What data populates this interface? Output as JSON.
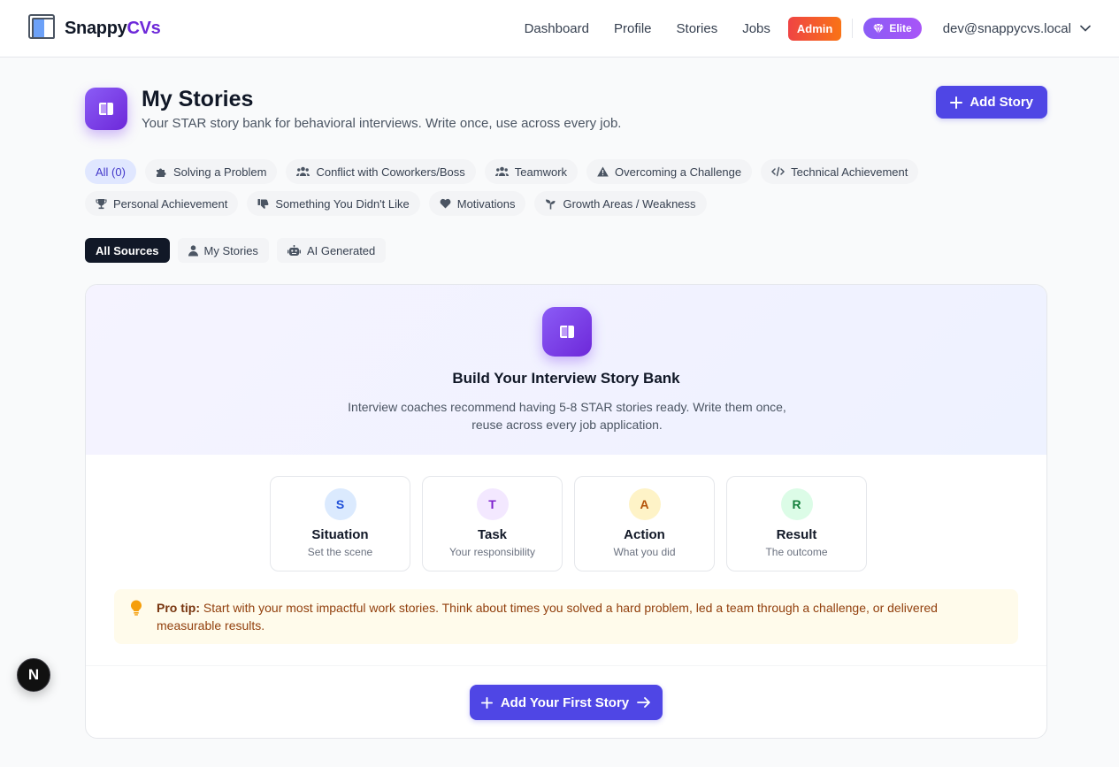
{
  "app": {
    "brand_part1": "Snappy",
    "brand_part2": "CVs",
    "accent": "#4f46e5",
    "brand_color": "#6d28d9"
  },
  "nav": {
    "links": [
      "Dashboard",
      "Profile",
      "Stories",
      "Jobs"
    ],
    "admin_badge": "Admin",
    "elite_badge": "Elite",
    "user_email": "dev@snappycvs.local"
  },
  "page": {
    "title": "My Stories",
    "subtitle": "Your STAR story bank for behavioral interviews. Write once, use across every job.",
    "add_button": "Add Story"
  },
  "categories": {
    "row1": [
      {
        "label": "All (0)",
        "icon": "none",
        "active": true
      },
      {
        "label": "Solving a Problem",
        "icon": "puzzle-icon"
      },
      {
        "label": "Conflict with Coworkers/Boss",
        "icon": "users-icon"
      },
      {
        "label": "Teamwork",
        "icon": "users-icon"
      },
      {
        "label": "Overcoming a Challenge",
        "icon": "warning-icon"
      },
      {
        "label": "Technical Achievement",
        "icon": "code-icon"
      }
    ],
    "row2": [
      {
        "label": "Personal Achievement",
        "icon": "trophy-icon"
      },
      {
        "label": "Something You Didn't Like",
        "icon": "thumbs-down-icon"
      },
      {
        "label": "Motivations",
        "icon": "heart-icon"
      },
      {
        "label": "Growth Areas / Weakness",
        "icon": "seedling-icon"
      }
    ]
  },
  "sources": [
    {
      "label": "All Sources",
      "active": true
    },
    {
      "label": "My Stories",
      "icon": "user-icon"
    },
    {
      "label": "AI Generated",
      "icon": "robot-icon"
    }
  ],
  "empty_state": {
    "title": "Build Your Interview Story Bank",
    "description": "Interview coaches recommend having 5-8 STAR stories ready. Write them once, reuse across every job application.",
    "star": [
      {
        "letter": "S",
        "name": "Situation",
        "desc": "Set the scene",
        "bg": "#dbeafe",
        "fg": "#1d4ed8"
      },
      {
        "letter": "T",
        "name": "Task",
        "desc": "Your responsibility",
        "bg": "#f3e8ff",
        "fg": "#7e22ce"
      },
      {
        "letter": "A",
        "name": "Action",
        "desc": "What you did",
        "bg": "#fef3c7",
        "fg": "#b45309"
      },
      {
        "letter": "R",
        "name": "Result",
        "desc": "The outcome",
        "bg": "#dcfce7",
        "fg": "#15803d"
      }
    ],
    "tip_label": "Pro tip:",
    "tip_text": " Start with your most impactful work stories. Think about times you solved a hard problem, led a team through a challenge, or delivered measurable results.",
    "cta": "Add Your First Story"
  },
  "dev_badge": "N"
}
